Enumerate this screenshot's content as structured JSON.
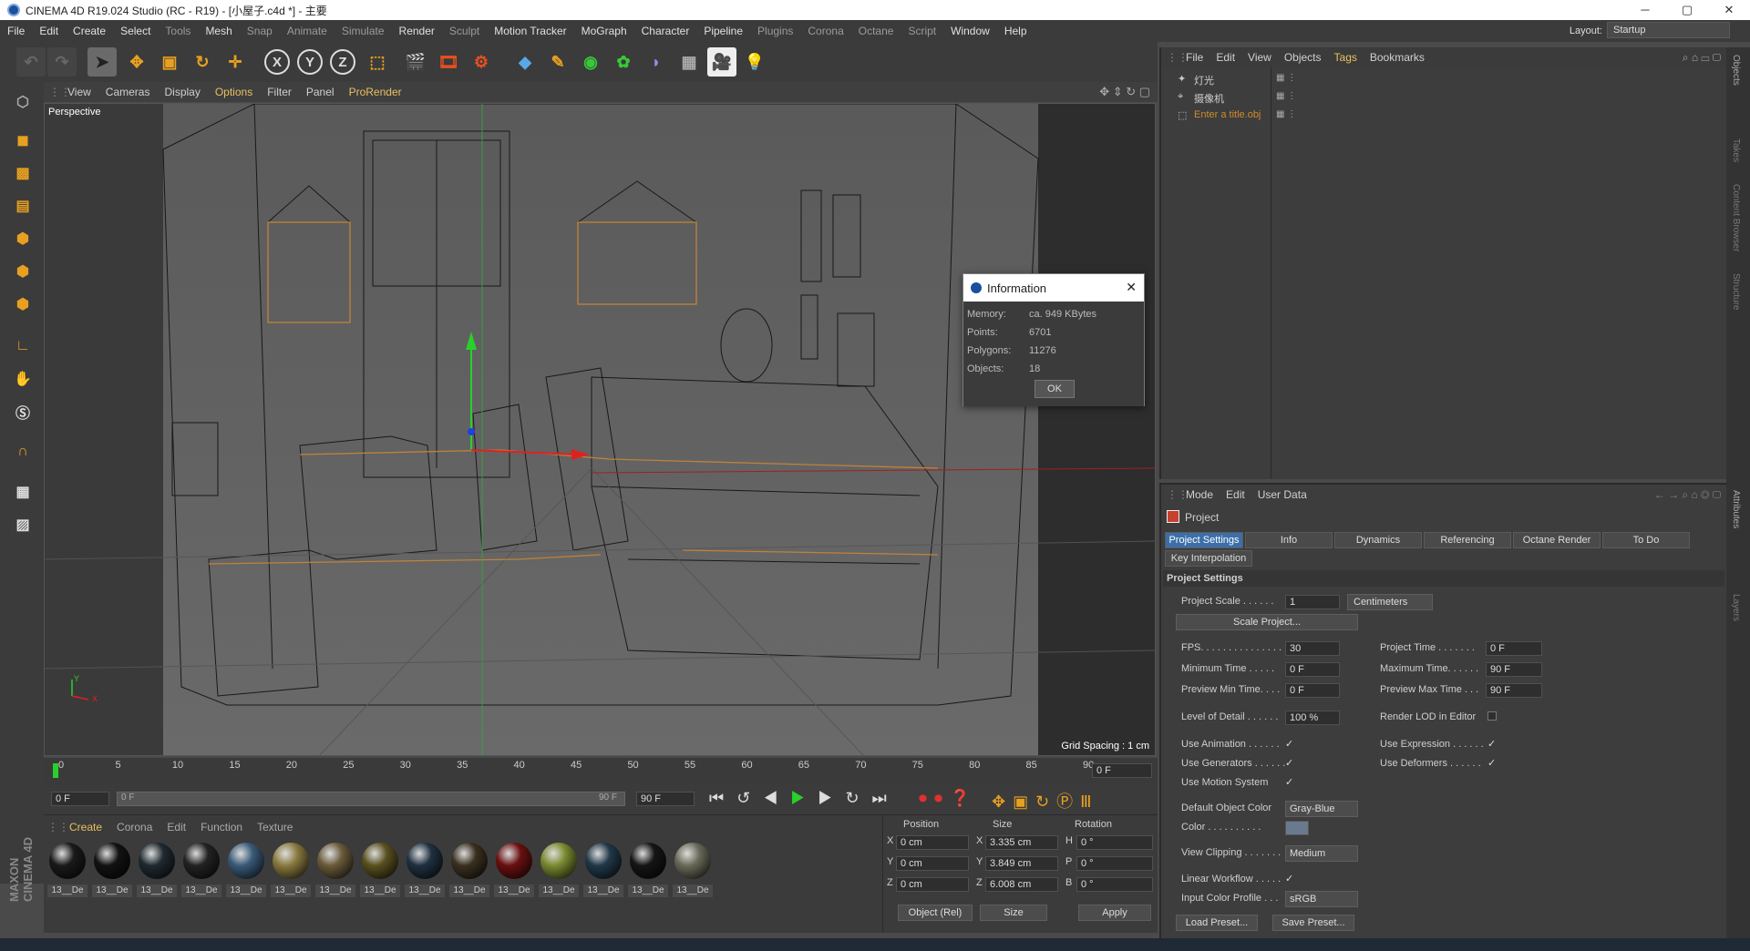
{
  "title_bar": {
    "text": "CINEMA 4D R19.024 Studio (RC - R19) - [小屋子.c4d *] - 主要",
    "min": "─",
    "max": "▢",
    "close": "✕"
  },
  "menu": {
    "items": [
      "File",
      "Edit",
      "Create",
      "Select",
      "Tools",
      "Mesh",
      "Snap",
      "Animate",
      "Simulate",
      "Render",
      "Sculpt",
      "Motion Tracker",
      "MoGraph",
      "Character",
      "Pipeline",
      "Plugins",
      "Corona",
      "Octane",
      "Script",
      "Window",
      "Help"
    ],
    "layout_label": "Layout:",
    "layout_value": "Startup"
  },
  "viewport": {
    "menu": [
      "View",
      "Cameras",
      "Display",
      "Options",
      "Filter",
      "Panel",
      "ProRender"
    ],
    "name": "Perspective",
    "grid_spacing": "Grid Spacing : 1 cm",
    "axis_y": "Y",
    "axis_x": "X"
  },
  "info_dialog": {
    "title": "Information",
    "rows": [
      {
        "k": "Memory:",
        "v": "ca. 949 KBytes"
      },
      {
        "k": "Points:",
        "v": "6701"
      },
      {
        "k": "Polygons:",
        "v": "11276"
      },
      {
        "k": "Objects:",
        "v": "18"
      }
    ],
    "ok": "OK",
    "close": "✕"
  },
  "timeline": {
    "ticks": [
      "0",
      "5",
      "10",
      "15",
      "20",
      "25",
      "30",
      "35",
      "40",
      "45",
      "50",
      "55",
      "60",
      "65",
      "70",
      "75",
      "80",
      "85",
      "90"
    ],
    "current": "0 F",
    "start": "0 F",
    "range_left": "0 F",
    "range_right": "90 F",
    "end": "90 F"
  },
  "materials": {
    "menu": [
      "Create",
      "Corona",
      "Edit",
      "Function",
      "Texture"
    ],
    "label": "13__De",
    "colors": [
      "#1a1a1a",
      "#121212",
      "#1f2a30",
      "#222",
      "#3a5a78",
      "#8a7a40",
      "#6a5a3a",
      "#5a5020",
      "#203040",
      "#3a3020",
      "#6a1010",
      "#7a8a30",
      "#203848",
      "#151515",
      "#6a6a5a"
    ]
  },
  "coords": {
    "headers": [
      "Position",
      "Size",
      "Rotation"
    ],
    "rows": [
      {
        "a": "X",
        "pos": "0 cm",
        "b": "X",
        "size": "3.335 cm",
        "c": "H",
        "rot": "0 °"
      },
      {
        "a": "Y",
        "pos": "0 cm",
        "b": "Y",
        "size": "3.849 cm",
        "c": "P",
        "rot": "0 °"
      },
      {
        "a": "Z",
        "pos": "0 cm",
        "b": "Z",
        "size": "6.008 cm",
        "c": "B",
        "rot": "0 °"
      }
    ],
    "mode1": "Object (Rel)",
    "mode2": "Size",
    "apply": "Apply"
  },
  "object_manager": {
    "menu": [
      "File",
      "Edit",
      "View",
      "Objects",
      "Tags",
      "Bookmarks"
    ],
    "objects": [
      {
        "name": "灯光",
        "color": "#cfcfcf"
      },
      {
        "name": "摄像机",
        "color": "#cfcfcf"
      },
      {
        "name": "Enter a title.obj",
        "color": "#d08a30"
      }
    ]
  },
  "attributes": {
    "menu": [
      "Mode",
      "Edit",
      "User Data"
    ],
    "object": "Project",
    "tabs": [
      "Project Settings",
      "Info",
      "Dynamics",
      "Referencing",
      "Octane Render",
      "To Do"
    ],
    "tab2": "Key Interpolation",
    "section": "Project Settings",
    "project_scale_label": "Project Scale . . . . . .",
    "project_scale": "1",
    "units": "Centimeters",
    "scale_btn": "Scale Project...",
    "fps_label": "FPS. . . . . . . . . . . . . . .",
    "fps": "30",
    "project_time_label": "Project Time . . . . . . .",
    "project_time": "0 F",
    "min_time_label": "Minimum Time . . . . .",
    "min_time": "0 F",
    "max_time_label": "Maximum Time. . . . . .",
    "max_time": "90 F",
    "prev_min_label": "Preview Min Time. . . .",
    "prev_min": "0 F",
    "prev_max_label": "Preview Max Time . . .",
    "prev_max": "90 F",
    "lod_label": "Level of Detail . . . . . .",
    "lod": "100 %",
    "render_lod_label": "Render LOD in Editor",
    "use_anim_label": "Use Animation . . . . . .",
    "use_expr_label": "Use Expression . . . . . .",
    "use_gen_label": "Use Generators . . . . . .",
    "use_def_label": "Use Deformers . . . . . .",
    "use_motion_label": "Use Motion System",
    "def_color_label": "Default Object Color",
    "def_color": "Gray-Blue",
    "color_label": "Color . . . . . . . . . .",
    "view_clip_label": "View Clipping . . . . . . .",
    "view_clip": "Medium",
    "linear_label": "Linear Workflow . . . . .",
    "input_color_label": "Input Color Profile . . .",
    "input_color": "sRGB",
    "load_preset": "Load Preset...",
    "save_preset": "Save Preset...",
    "check": "✓"
  },
  "side_tabs": [
    "Objects",
    "Takes",
    "Content Browser",
    "Structure",
    "Attributes",
    "Layers"
  ],
  "brand": "MAXON CINEMA 4D"
}
